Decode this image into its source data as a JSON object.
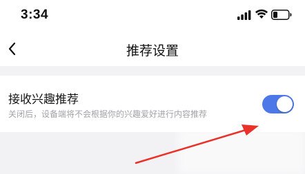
{
  "status_bar": {
    "time": "3:34"
  },
  "icons": {
    "signal": "cellular-signal-icon",
    "wifi": "wifi-icon",
    "battery": "battery-icon",
    "back": "chevron-left-icon"
  },
  "nav": {
    "title": "推荐设置"
  },
  "setting": {
    "title": "接收兴趣推荐",
    "description": "关闭后，设备端将不会根据你的兴趣爱好进行内容推荐",
    "enabled": true
  },
  "colors": {
    "toggle_on": "#4d79e8",
    "annotation_arrow": "#e8322a",
    "background": "#f2f2f4"
  }
}
